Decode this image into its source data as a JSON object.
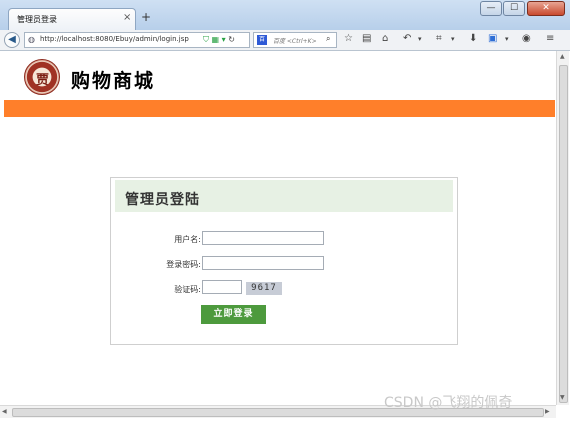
{
  "browser": {
    "tab_title": "管理员登录",
    "tab_close": "×",
    "new_tab": "+",
    "url": "http://localhost:8080/Ebuy/admin/login.jsp",
    "search_engine_label": "百",
    "search_placeholder": "百度 <Ctrl+K>",
    "window_buttons": [
      "—",
      "☐",
      "✕"
    ]
  },
  "header": {
    "site_name": "购物商城",
    "logo_glyph": "贾",
    "bar_color": "#ff7f2a"
  },
  "login": {
    "title": "管理员登陆",
    "username_label": "用户名:",
    "username_value": "",
    "password_label": "登录密码:",
    "password_value": "",
    "captcha_label": "验证码:",
    "captcha_value": "",
    "captcha_image_text": "9617",
    "submit_label": "立即登录",
    "accent_color": "#4d9a3d"
  },
  "watermark": "CSDN @飞翔的佩奇"
}
